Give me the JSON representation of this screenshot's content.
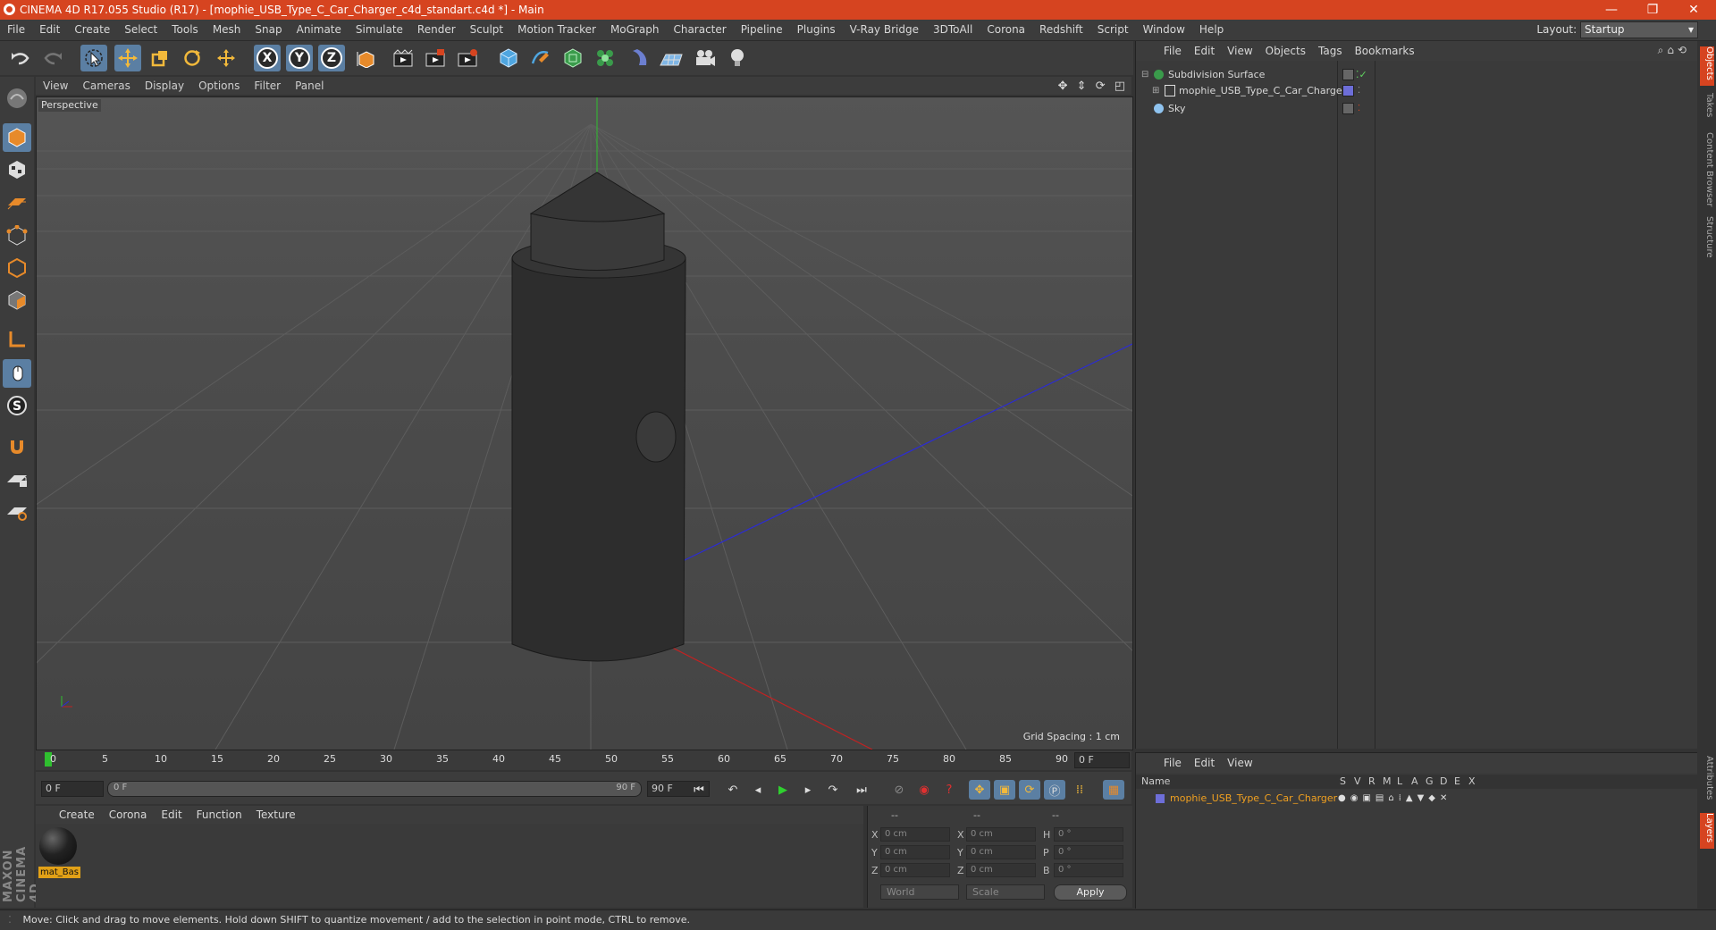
{
  "window": {
    "title": "CINEMA 4D R17.055 Studio (R17) - [mophie_USB_Type_C_Car_Charger_c4d_standart.c4d *] - Main",
    "accent": "#d64420",
    "minimize": "—",
    "restore": "❐",
    "close": "✕"
  },
  "menu": [
    "File",
    "Edit",
    "Create",
    "Select",
    "Tools",
    "Mesh",
    "Snap",
    "Animate",
    "Simulate",
    "Render",
    "Sculpt",
    "Motion Tracker",
    "MoGraph",
    "Character",
    "Pipeline",
    "Plugins",
    "V-Ray Bridge",
    "3DToAll",
    "Corona",
    "Redshift",
    "Script",
    "Window",
    "Help"
  ],
  "layout": {
    "label": "Layout:",
    "value": "Startup"
  },
  "viewport": {
    "menu": [
      "View",
      "Cameras",
      "Display",
      "Options",
      "Filter",
      "Panel"
    ],
    "camera_label": "Perspective",
    "grid_spacing": "Grid Spacing : 1 cm"
  },
  "objects": {
    "menu": [
      "File",
      "Edit",
      "View",
      "Objects",
      "Tags",
      "Bookmarks"
    ],
    "items": [
      {
        "name": "Subdivision Surface"
      },
      {
        "name": "mophie_USB_Type_C_Car_Charger"
      },
      {
        "name": "Sky"
      }
    ]
  },
  "side_tabs": [
    "Objects",
    "Takes",
    "Content Browser",
    "Structure",
    "Attributes",
    "Layers"
  ],
  "timeline": {
    "ticks": [
      "0",
      "5",
      "10",
      "15",
      "20",
      "25",
      "30",
      "35",
      "40",
      "45",
      "50",
      "55",
      "60",
      "65",
      "70",
      "75",
      "80",
      "85",
      "90"
    ],
    "current_frame": "0 F",
    "start_field": "0 F",
    "range_start": "0 F",
    "range_end": "90 F",
    "end_field": "90 F"
  },
  "materials": {
    "menu": [
      "Create",
      "Corona",
      "Edit",
      "Function",
      "Texture"
    ],
    "items": [
      {
        "name": "mat_Bas"
      }
    ]
  },
  "coordinates": {
    "header": [
      "--",
      "--",
      "--"
    ],
    "rows": [
      {
        "axis": "X",
        "pos": "0 cm",
        "axis2": "X",
        "size": "0 cm",
        "rot_label": "H",
        "rot": "0 °"
      },
      {
        "axis": "Y",
        "pos": "0 cm",
        "axis2": "Y",
        "size": "0 cm",
        "rot_label": "P",
        "rot": "0 °"
      },
      {
        "axis": "Z",
        "pos": "0 cm",
        "axis2": "Z",
        "size": "0 cm",
        "rot_label": "B",
        "rot": "0 °"
      }
    ],
    "mode": "World",
    "scale": "Scale",
    "apply": "Apply"
  },
  "layers": {
    "menu": [
      "File",
      "Edit",
      "View"
    ],
    "columns": [
      "Name",
      "S",
      "V",
      "R",
      "M",
      "L",
      "A",
      "G",
      "D",
      "E",
      "X"
    ],
    "items": [
      {
        "name": "mophie_USB_Type_C_Car_Charger",
        "color": "#6d6ed8"
      }
    ]
  },
  "status": "Move: Click and drag to move elements. Hold down SHIFT to quantize movement / add to the selection in point mode, CTRL to remove."
}
